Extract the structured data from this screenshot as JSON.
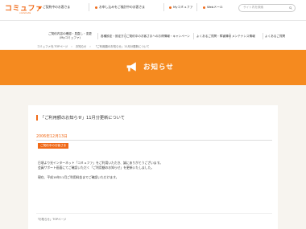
{
  "header": {
    "logo_main": "コミュファ",
    "logo_sub": "commufa",
    "search_placeholder": "サイト内を検索",
    "nav_top": [
      {
        "label": "ご契約中のお客さま"
      },
      {
        "label": "お申し込みをご検討中のお客さま"
      },
      {
        "label": "Myコミュファ"
      },
      {
        "label": "Webメール"
      }
    ],
    "nav_main": [
      {
        "label": "ご契約内容の確認・見直し・変更",
        "sub": "(Myコミュファ)"
      },
      {
        "label": "各種設定・設定方法"
      },
      {
        "label": "ご契約中のお客さまへのお得情報・キャンペーン"
      },
      {
        "label": "よくあるご質問・障害情報"
      },
      {
        "label": "メンテナンス情報"
      }
    ],
    "nav_faq": "よくあるご質問"
  },
  "breadcrumb": [
    "コミュファ光 TOPページ",
    "お知らせ",
    "「ご利用額のお知らせ」11月分更新について"
  ],
  "hero": {
    "title": "お知らせ"
  },
  "article": {
    "title": "「ご利用額のお知らせ」11月分更新について",
    "date": "2006年12月13日",
    "badge": "ご契約中のお客さま",
    "paragraphs": [
      "日頃より光インターネット「コミュファ」をご利用いただき、誠にありがとうございます。",
      "会員サポート画面にてご確認いただく「ご利用額のお知らせ」を更新いたしました。",
      "",
      "現在、平成18年11月ご利用料金までご確認いただけます。"
    ],
    "back_link": "「お知らせ」TOPページ"
  },
  "colors": {
    "accent": "#f06a18",
    "hero_bg": "#f58a1f",
    "content_bg": "#f7f4ef"
  }
}
